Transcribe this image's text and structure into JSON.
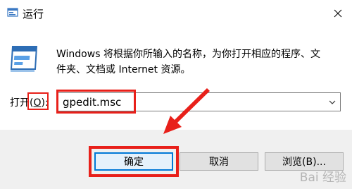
{
  "window": {
    "title": "运行",
    "close_icon": "close-icon",
    "app_icon": "run-dialog-icon"
  },
  "content": {
    "description_line1": "Windows 将根据你所输入的名称，为你打开相应的程序、文",
    "description_line2": "件夹、文档或 Internet 资源。",
    "open_label_prefix": "打开(",
    "open_label_key": "O",
    "open_label_suffix": "):",
    "input_value": "gpedit.msc",
    "dropdown_icon": "chevron-down-icon"
  },
  "buttons": {
    "ok": "确定",
    "cancel": "取消",
    "browse": "浏览(B)..."
  },
  "annotation": {
    "highlight_color": "#e8201a",
    "arrow_color": "#e8201a"
  },
  "watermark": {
    "text": "Bai 经验"
  }
}
